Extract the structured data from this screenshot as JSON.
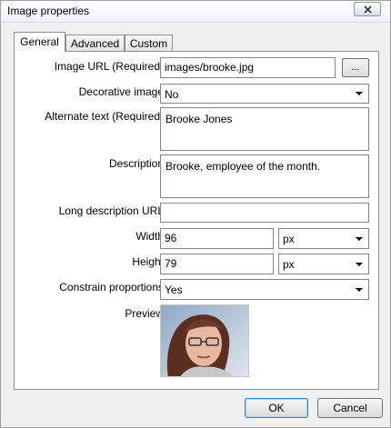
{
  "window": {
    "title": "Image properties"
  },
  "tabs": [
    {
      "label": "General",
      "active": true
    },
    {
      "label": "Advanced",
      "active": false
    },
    {
      "label": "Custom",
      "active": false
    }
  ],
  "form": {
    "image_url": {
      "label": "Image URL (Required)",
      "value": "images/brooke.jpg",
      "browse_label": "..."
    },
    "decorative": {
      "label": "Decorative image",
      "value": "No"
    },
    "alt_text": {
      "label": "Alternate text (Required)",
      "value": "Brooke Jones"
    },
    "description": {
      "label": "Description",
      "value": "Brooke, employee of the month."
    },
    "long_desc": {
      "label": "Long description URL",
      "value": ""
    },
    "width": {
      "label": "Width",
      "value": "96",
      "unit": "px"
    },
    "height": {
      "label": "Height",
      "value": "79",
      "unit": "px"
    },
    "constrain": {
      "label": "Constrain proportions",
      "value": "Yes"
    },
    "preview": {
      "label": "Preview"
    }
  },
  "buttons": {
    "ok": "OK",
    "cancel": "Cancel"
  }
}
